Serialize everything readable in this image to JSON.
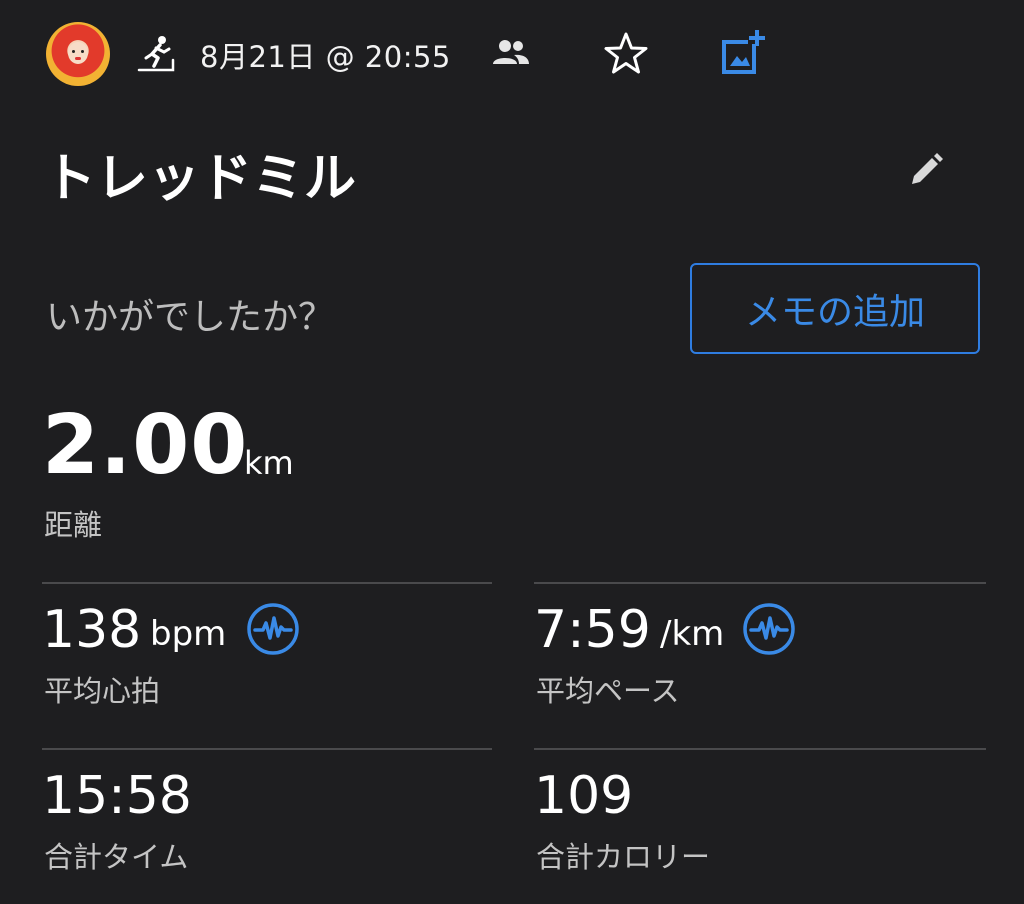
{
  "header": {
    "date_time": "8月21日 @ 20:55",
    "icons": [
      "avatar",
      "treadmill-icon",
      "people-icon",
      "star-icon",
      "add-photo-icon"
    ]
  },
  "activity": {
    "title": "トレッドミル",
    "prompt": "いかがでしたか？",
    "memo_button_label": "メモの追加"
  },
  "distance": {
    "value": "2.00",
    "unit": "km",
    "label": "距離"
  },
  "stats": [
    {
      "value": "138",
      "unit": "bpm",
      "label": "平均心拍",
      "icon": "heart-rate-icon"
    },
    {
      "value": "7:59",
      "unit": "/km",
      "label": "平均ペース",
      "icon": "heart-rate-icon"
    },
    {
      "value": "15:58",
      "unit": "",
      "label": "合計タイム"
    },
    {
      "value": "109",
      "unit": "",
      "label": "合計カロリー"
    }
  ],
  "colors": {
    "background": "#1e1e20",
    "accent": "#3a8ae6",
    "divider": "#4a4a4c",
    "secondary_text": "#c4c4c4"
  }
}
